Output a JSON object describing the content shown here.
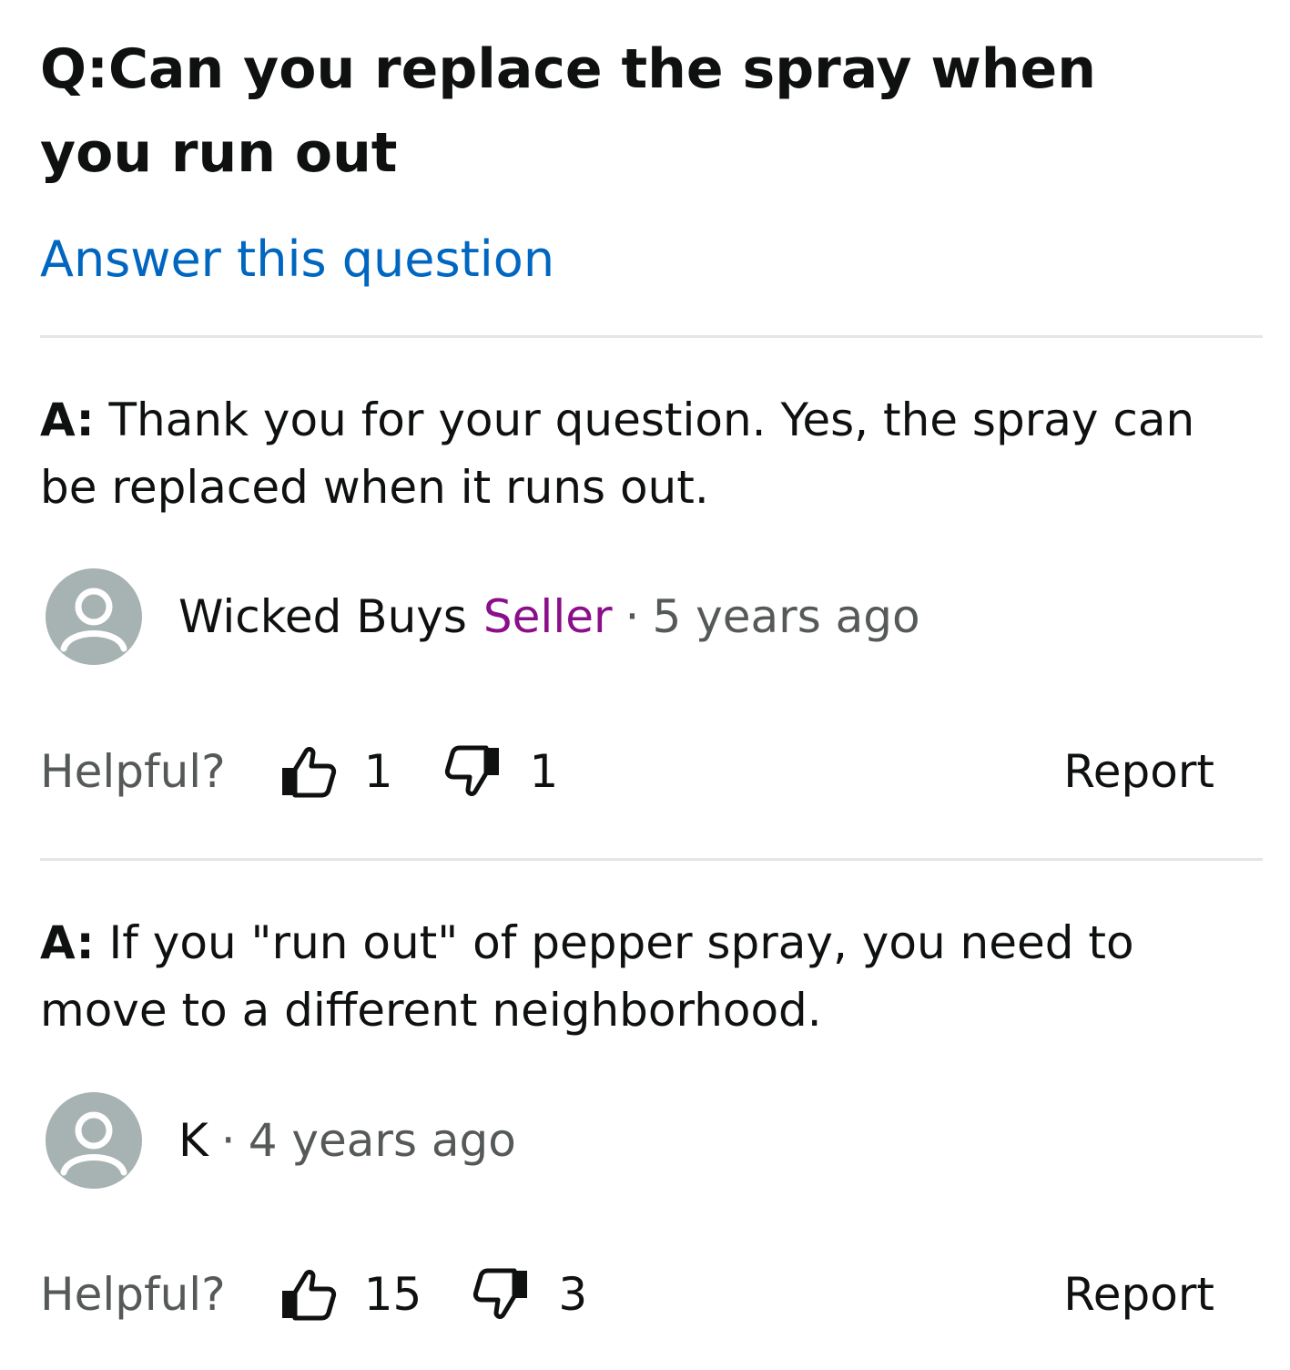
{
  "question": {
    "prefix": "Q:",
    "text": "Can you replace the spray when you run out"
  },
  "answer_link": "Answer this question",
  "answers": [
    {
      "prefix": "A:",
      "text": " Thank you for your question. Yes, the spray can be replaced when it runs out.",
      "author": "Wicked Buys",
      "badge": "Seller",
      "separator": "·",
      "time": "5 years ago",
      "helpful_label": "Helpful?",
      "upvotes": "1",
      "downvotes": "1",
      "report": "Report"
    },
    {
      "prefix": "A:",
      "text": " If you \"run out\" of pepper spray, you need to move to a different neighborhood.",
      "author": "K",
      "separator": "·",
      "time": "4 years ago",
      "helpful_label": "Helpful?",
      "upvotes": "15",
      "downvotes": "3",
      "report": "Report"
    }
  ],
  "colors": {
    "link": "#0066c0",
    "seller_badge": "#8b0e8b",
    "secondary_text": "#565959",
    "avatar_bg": "#a7b2b2",
    "divider": "#e3e6e6"
  },
  "icons": [
    "avatar-placeholder-icon",
    "thumbs-up-icon",
    "thumbs-down-icon"
  ]
}
